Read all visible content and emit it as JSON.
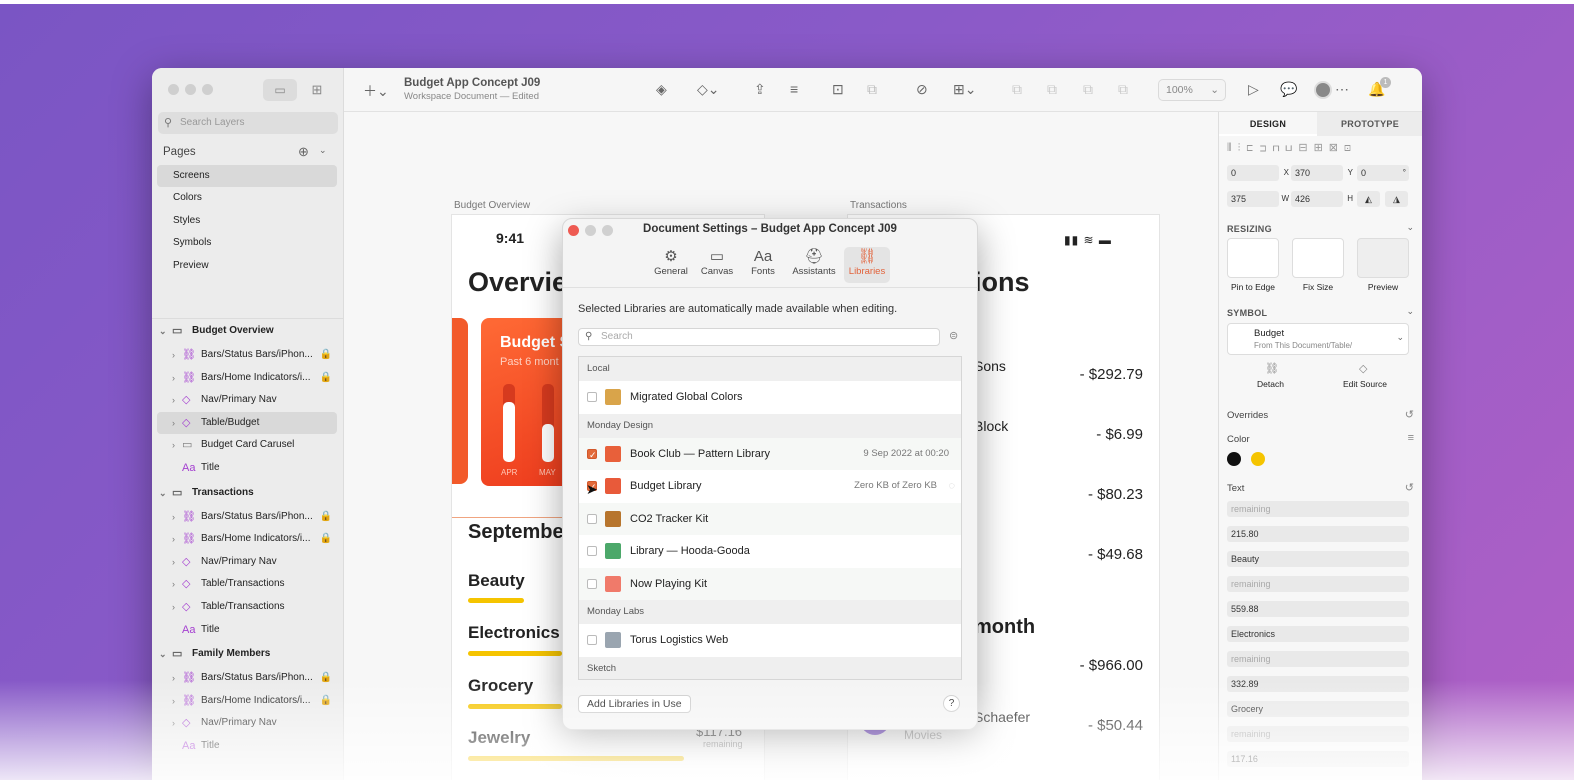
{
  "colors": {
    "accent": "#e2623a",
    "swatch_black": "#111111",
    "swatch_yellow": "#f5c400"
  },
  "document": {
    "title": "Budget App Concept J09",
    "subtitle": "Workspace Document — Edited"
  },
  "toolbar": {
    "zoom": "100%",
    "notif_count": "1"
  },
  "sidebar": {
    "search_placeholder": "Search Layers",
    "pages_label": "Pages",
    "pages": [
      "Screens",
      "Colors",
      "Styles",
      "Symbols",
      "Preview"
    ],
    "groups": [
      {
        "name": "Budget Overview",
        "items": [
          {
            "label": "Bars/Status Bars/iPhon...",
            "icon": "symbol-icon",
            "lock": true
          },
          {
            "label": "Bars/Home Indicators/i...",
            "icon": "symbol-icon",
            "lock": true
          },
          {
            "label": "Nav/Primary Nav",
            "icon": "diamond-icon",
            "lock": false
          },
          {
            "label": "Table/Budget",
            "icon": "diamond-icon",
            "lock": false,
            "selected": true
          },
          {
            "label": "Budget Card Carusel",
            "icon": "folder-icon",
            "lock": false
          },
          {
            "label": "Title",
            "icon": "text-icon",
            "lock": false
          }
        ]
      },
      {
        "name": "Transactions",
        "items": [
          {
            "label": "Bars/Status Bars/iPhon...",
            "icon": "symbol-icon",
            "lock": true
          },
          {
            "label": "Bars/Home Indicators/i...",
            "icon": "symbol-icon",
            "lock": true
          },
          {
            "label": "Nav/Primary Nav",
            "icon": "diamond-icon",
            "lock": false
          },
          {
            "label": "Table/Transactions",
            "icon": "diamond-icon",
            "lock": false
          },
          {
            "label": "Table/Transactions",
            "icon": "diamond-icon",
            "lock": false
          },
          {
            "label": "Title",
            "icon": "text-icon",
            "lock": false
          }
        ]
      },
      {
        "name": "Family Members",
        "items": [
          {
            "label": "Bars/Status Bars/iPhon...",
            "icon": "symbol-icon",
            "lock": true
          },
          {
            "label": "Bars/Home Indicators/i...",
            "icon": "symbol-icon",
            "lock": true
          },
          {
            "label": "Nav/Primary Nav",
            "icon": "diamond-icon",
            "lock": false
          },
          {
            "label": "Title",
            "icon": "text-icon",
            "lock": false
          }
        ]
      }
    ]
  },
  "canvas": {
    "artboard1_label": "Budget Overview",
    "artboard2_label": "Transactions",
    "time": "9:41",
    "overview_title": "Overvie",
    "card_title": "Budget S",
    "card_sub": "Past 6 mont",
    "months": [
      "APR",
      "MAY"
    ],
    "month_heading": "September",
    "categories": [
      "Beauty",
      "Electronics",
      "Grocery",
      "Jewelry"
    ],
    "jewelry_amount": "$117.16",
    "jewelry_remaining": "remaining",
    "tx_title": "ions",
    "tx_names": [
      "Sons",
      "Block",
      "Schaefer"
    ],
    "tx_sub": "Movies",
    "tx_amounts": [
      "- $292.79",
      "- $6.99",
      "- $80.23",
      "- $49.68",
      "- $966.00",
      "- $50.44"
    ],
    "month_label": "month"
  },
  "inspector": {
    "tabs": [
      "DESIGN",
      "PROTOTYPE"
    ],
    "x": "0",
    "x_label": "X",
    "y": "370",
    "y_label": "Y",
    "rot": "0",
    "rot_label": "°",
    "w": "375",
    "w_label": "W",
    "h": "426",
    "h_label": "H",
    "resizing_label": "RESIZING",
    "resize_options": [
      "Pin to Edge",
      "Fix Size",
      "Preview"
    ],
    "symbol_label": "SYMBOL",
    "symbol_name": "Budget",
    "symbol_source": "From This Document/Table/",
    "detach": "Detach",
    "edit_source": "Edit Source",
    "overrides": "Overrides",
    "color_label": "Color",
    "text_label": "Text",
    "text_fields": [
      "remaining",
      "215.80",
      "Beauty",
      "remaining",
      "559.88",
      "Electronics",
      "remaining",
      "332.89",
      "Grocery",
      "remaining",
      "117.16"
    ]
  },
  "modal": {
    "title": "Document Settings – Budget App Concept J09",
    "tabs": [
      "General",
      "Canvas",
      "Fonts",
      "Assistants",
      "Libraries"
    ],
    "description": "Selected Libraries are automatically made available when editing.",
    "search_placeholder": "Search",
    "sections": [
      {
        "header": "Local",
        "items": [
          {
            "name": "Migrated Global Colors",
            "checked": false,
            "meta": ""
          }
        ]
      },
      {
        "header": "Monday Design",
        "items": [
          {
            "name": "Book Club — Pattern Library",
            "checked": true,
            "meta": "9 Sep 2022 at 00:20"
          },
          {
            "name": "Budget Library",
            "checked": true,
            "meta": "Zero KB of Zero KB"
          },
          {
            "name": "CO2 Tracker Kit",
            "checked": false,
            "meta": ""
          },
          {
            "name": "Library — Hooda-Gooda",
            "checked": false,
            "meta": ""
          },
          {
            "name": "Now Playing Kit",
            "checked": false,
            "meta": ""
          }
        ]
      },
      {
        "header": "Monday Labs",
        "items": [
          {
            "name": "Torus Logistics Web",
            "checked": false,
            "meta": ""
          }
        ]
      },
      {
        "header": "Sketch",
        "items": []
      }
    ],
    "add_button": "Add Libraries in Use",
    "help": "?"
  }
}
